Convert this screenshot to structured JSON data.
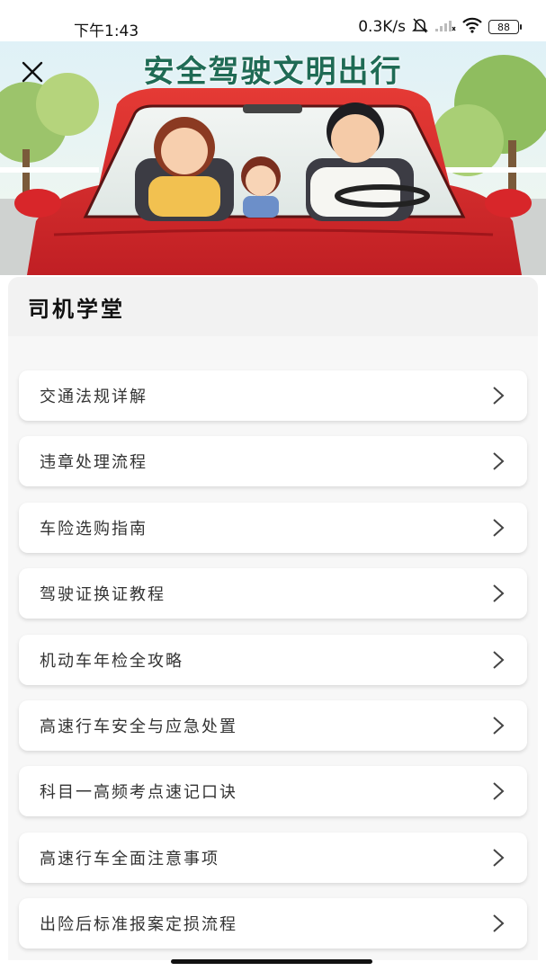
{
  "status_bar": {
    "time": "下午1:43",
    "net_speed": "0.3K/s",
    "battery": "88"
  },
  "banner": {
    "title": "安全驾驶文明出行",
    "image": "family-in-red-car-illustration",
    "close_icon": "close-icon"
  },
  "section": {
    "title": "司机学堂"
  },
  "items": [
    {
      "label": "交通法规详解"
    },
    {
      "label": "违章处理流程"
    },
    {
      "label": "车险选购指南"
    },
    {
      "label": "驾驶证换证教程"
    },
    {
      "label": "机动车年检全攻略"
    },
    {
      "label": "高速行车安全与应急处置"
    },
    {
      "label": "科目一高频考点速记口诀"
    },
    {
      "label": "高速行车全面注意事项"
    },
    {
      "label": "出险后标准报案定损流程"
    }
  ],
  "colors": {
    "title_green": "#1f6b55",
    "car_red": "#d8262a",
    "card_bg": "#f7f7f7"
  }
}
